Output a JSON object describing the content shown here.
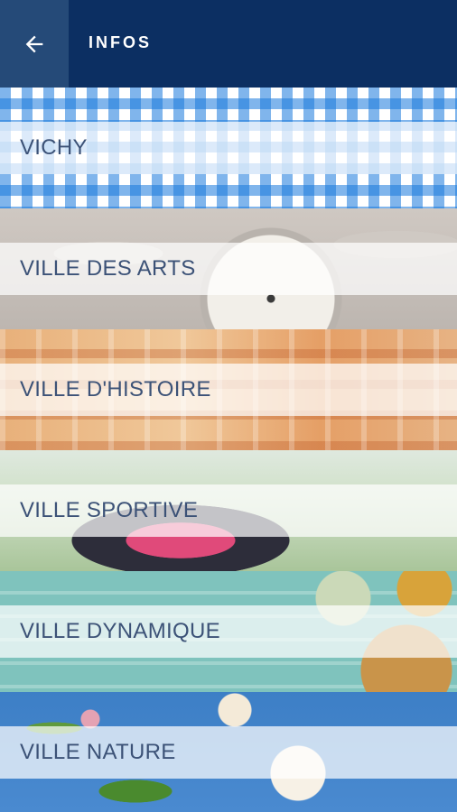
{
  "appbar": {
    "title": "INFOS",
    "back_icon": "arrow-left-icon"
  },
  "items": [
    {
      "label": "VICHY"
    },
    {
      "label": "VILLE DES ARTS"
    },
    {
      "label": "VILLE D'HISTOIRE"
    },
    {
      "label": "VILLE SPORTIVE"
    },
    {
      "label": "VILLE DYNAMIQUE"
    },
    {
      "label": "VILLE NATURE"
    }
  ],
  "colors": {
    "appbar": "#0c2f62",
    "back_button": "#254a78",
    "label_text": "#3c5277"
  }
}
